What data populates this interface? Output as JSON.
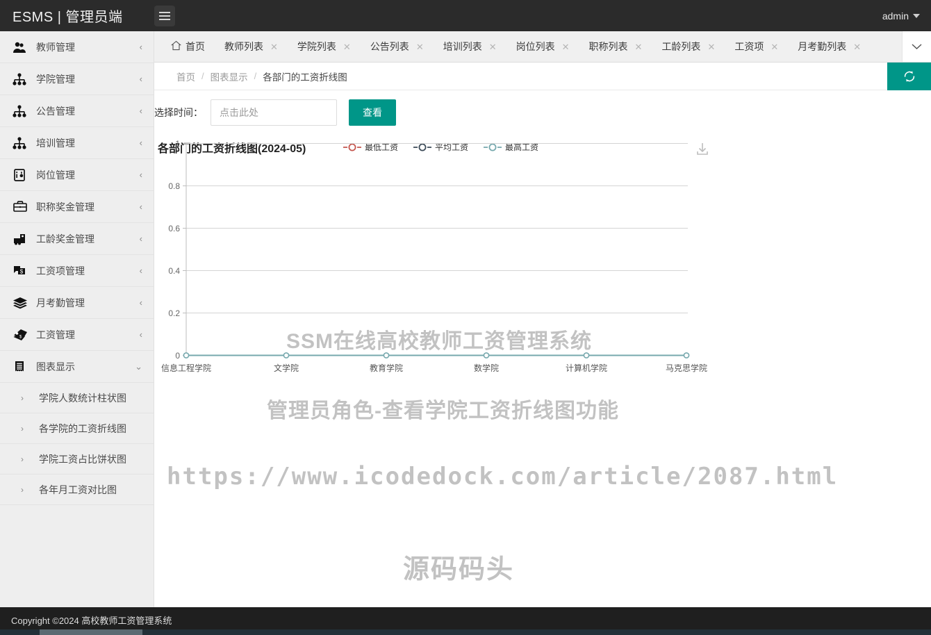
{
  "header": {
    "brand": "ESMS | 管理员端",
    "menu_toggle_icon": "hamburger-icon",
    "user": "admin"
  },
  "sidebar": {
    "items": [
      {
        "label": "教师管理",
        "icon": "users-icon",
        "arrow": "‹"
      },
      {
        "label": "学院管理",
        "icon": "sitemap-icon",
        "arrow": "‹"
      },
      {
        "label": "公告管理",
        "icon": "sitemap-icon",
        "arrow": "‹"
      },
      {
        "label": "培训管理",
        "icon": "sitemap-icon",
        "arrow": "‹"
      },
      {
        "label": "岗位管理",
        "icon": "id-badge-icon",
        "arrow": "‹"
      },
      {
        "label": "职称奖金管理",
        "icon": "briefcase-icon",
        "arrow": "‹"
      },
      {
        "label": "工龄奖金管理",
        "icon": "toolbox-icon",
        "arrow": "‹"
      },
      {
        "label": "工资项管理",
        "icon": "money-note-icon",
        "arrow": "‹"
      },
      {
        "label": "月考勤管理",
        "icon": "layers-icon",
        "arrow": "‹"
      },
      {
        "label": "工资管理",
        "icon": "tag-money-icon",
        "arrow": "‹"
      },
      {
        "label": "图表显示",
        "icon": "chart-list-icon",
        "arrow": "⌄"
      }
    ],
    "sub_items": [
      {
        "label": "学院人数统计柱状图",
        "arrow": "›"
      },
      {
        "label": "各学院的工资折线图",
        "arrow": "›"
      },
      {
        "label": "学院工资占比饼状图",
        "arrow": "›"
      },
      {
        "label": "各年月工资对比图",
        "arrow": "›"
      }
    ]
  },
  "tabs": {
    "home": {
      "label": "首页",
      "icon": "home-icon"
    },
    "items": [
      {
        "label": "教师列表",
        "close": "✕"
      },
      {
        "label": "学院列表",
        "close": "✕"
      },
      {
        "label": "公告列表",
        "close": "✕"
      },
      {
        "label": "培训列表",
        "close": "✕"
      },
      {
        "label": "岗位列表",
        "close": "✕"
      },
      {
        "label": "职称列表",
        "close": "✕"
      },
      {
        "label": "工龄列表",
        "close": "✕"
      },
      {
        "label": "工资项",
        "close": "✕"
      },
      {
        "label": "月考勤列表",
        "close": "✕"
      }
    ],
    "more_icon": "chevron-down-icon"
  },
  "breadcrumb": {
    "items": [
      "首页",
      "图表显示",
      "各部门的工资折线图"
    ],
    "separator": "/",
    "refresh_icon": "refresh-icon"
  },
  "filter": {
    "label": "选择时间：",
    "date_value": "",
    "date_placeholder": "点击此处",
    "submit_label": "查看"
  },
  "watermarks": {
    "line1": "SSM在线高校教师工资管理系统",
    "line2": "管理员角色-查看学院工资折线图功能",
    "line3": "https://www.icodedock.com/article/2087.html",
    "line4": "源码码头"
  },
  "colors": {
    "accent": "#009688",
    "series_min": "#c4564e",
    "series_avg": "#3b4a57",
    "series_max": "#76a8ad",
    "topbar": "#2b2b2b",
    "sidebar": "#eeeeee"
  },
  "chart_toolbox": {
    "download_icon": "download-icon",
    "download_title": "保存为图片"
  },
  "footer": {
    "text": "Copyright ©2024 高校教师工资管理系统"
  },
  "chart_data": {
    "type": "line",
    "title": "各部门的工资折线图(2024-05)",
    "xlabel": "",
    "ylabel": "",
    "categories": [
      "信息工程学院",
      "文学院",
      "教育学院",
      "数学院",
      "计算机学院",
      "马克思学院"
    ],
    "series": [
      {
        "name": "最低工资",
        "color": "#c4564e",
        "values": [
          0,
          0,
          0,
          0,
          0,
          0
        ]
      },
      {
        "name": "平均工资",
        "color": "#3b4a57",
        "values": [
          0,
          0,
          0,
          0,
          0,
          0
        ]
      },
      {
        "name": "最高工资",
        "color": "#76a8ad",
        "values": [
          0,
          0,
          0,
          0,
          0,
          0
        ]
      }
    ],
    "ylim": [
      0,
      1
    ],
    "yticks": [
      "0",
      "0.2",
      "0.4",
      "0.6",
      "0.8",
      "1"
    ],
    "grid": true,
    "legend_position": "top"
  }
}
